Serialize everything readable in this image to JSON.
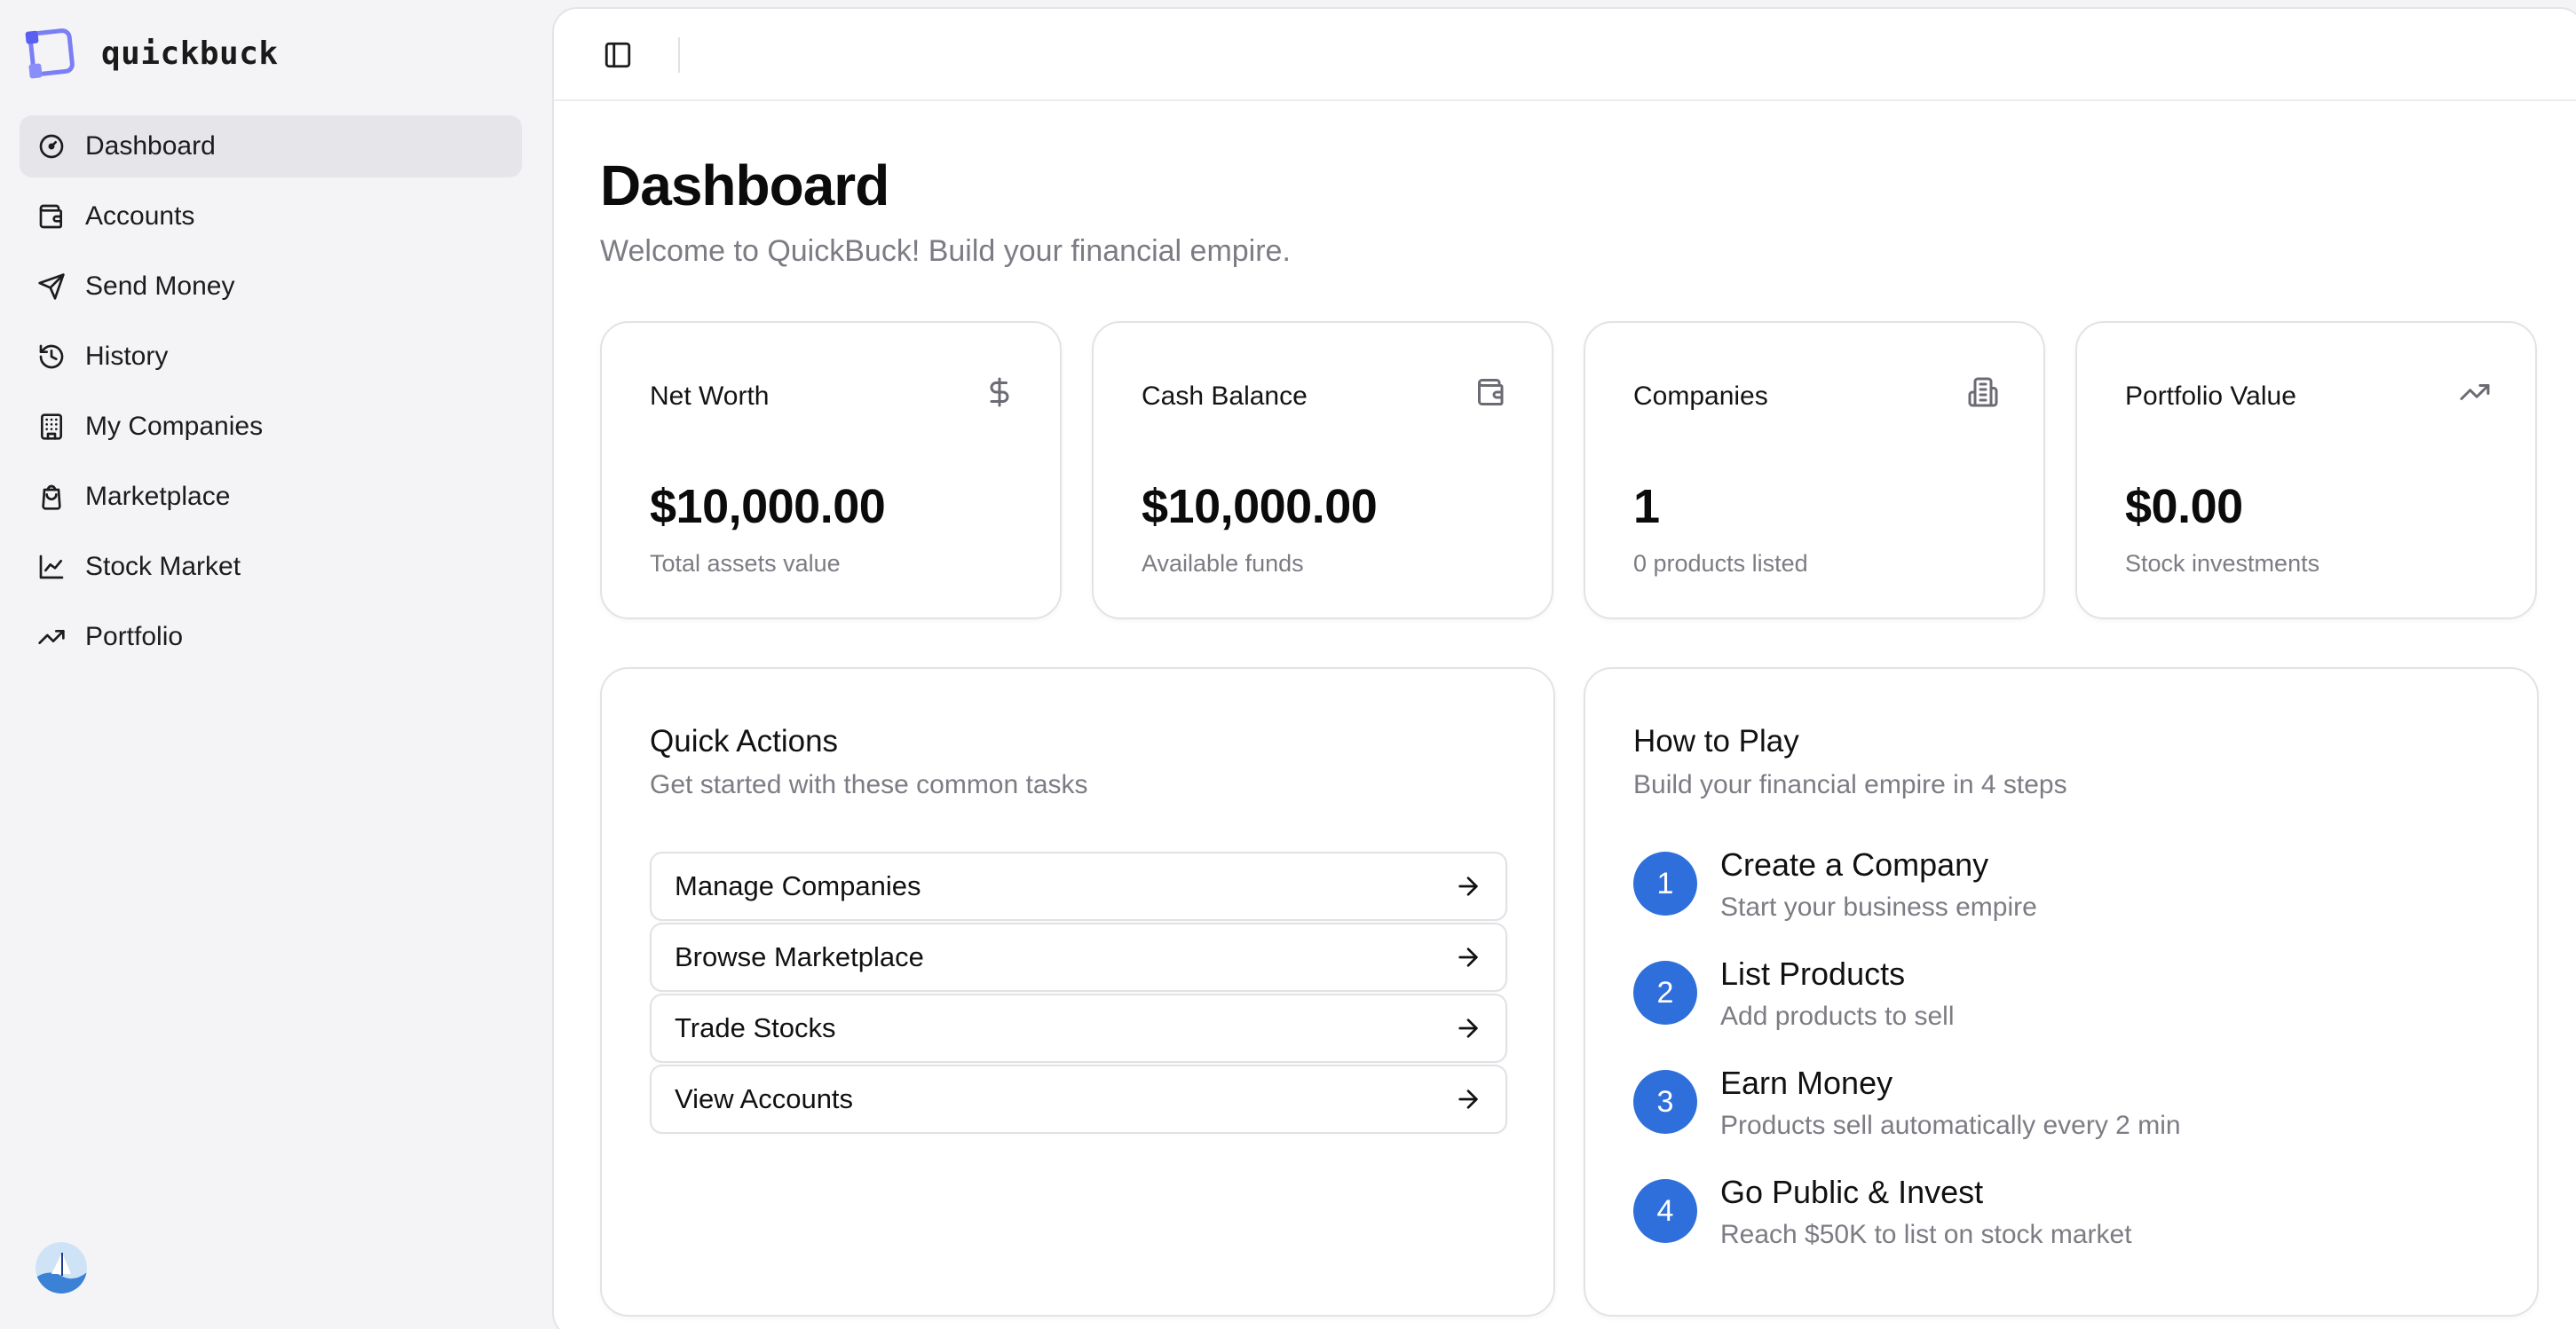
{
  "app": {
    "name": "quickbuck"
  },
  "sidebar": {
    "items": [
      {
        "label": "Dashboard",
        "icon": "gauge-icon",
        "active": true
      },
      {
        "label": "Accounts",
        "icon": "wallet-icon",
        "active": false
      },
      {
        "label": "Send Money",
        "icon": "send-icon",
        "active": false
      },
      {
        "label": "History",
        "icon": "history-icon",
        "active": false
      },
      {
        "label": "My Companies",
        "icon": "building-icon",
        "active": false
      },
      {
        "label": "Marketplace",
        "icon": "shopping-bag-icon",
        "active": false
      },
      {
        "label": "Stock Market",
        "icon": "line-chart-icon",
        "active": false
      },
      {
        "label": "Portfolio",
        "icon": "trending-up-icon",
        "active": false
      }
    ]
  },
  "header": {
    "title": "Dashboard",
    "subtitle": "Welcome to QuickBuck! Build your financial empire."
  },
  "stats": [
    {
      "label": "Net Worth",
      "value": "$10,000.00",
      "caption": "Total assets value",
      "icon": "dollar-icon"
    },
    {
      "label": "Cash Balance",
      "value": "$10,000.00",
      "caption": "Available funds",
      "icon": "wallet-icon"
    },
    {
      "label": "Companies",
      "value": "1",
      "caption": "0 products listed",
      "icon": "building-icon"
    },
    {
      "label": "Portfolio Value",
      "value": "$0.00",
      "caption": "Stock investments",
      "icon": "trending-up-icon"
    }
  ],
  "quick_actions": {
    "title": "Quick Actions",
    "subtitle": "Get started with these common tasks",
    "items": [
      {
        "label": "Manage Companies"
      },
      {
        "label": "Browse Marketplace"
      },
      {
        "label": "Trade Stocks"
      },
      {
        "label": "View Accounts"
      }
    ]
  },
  "how_to_play": {
    "title": "How to Play",
    "subtitle": "Build your financial empire in 4 steps",
    "steps": [
      {
        "number": "1",
        "title": "Create a Company",
        "desc": "Start your business empire"
      },
      {
        "number": "2",
        "title": "List Products",
        "desc": "Add products to sell"
      },
      {
        "number": "3",
        "title": "Earn Money",
        "desc": "Products sell automatically every 2 min"
      },
      {
        "number": "4",
        "title": "Go Public & Invest",
        "desc": "Reach $50K to list on stock market"
      }
    ]
  },
  "colors": {
    "accent": "#2f6fdc",
    "logo": "#6366f1",
    "sidebar_bg": "#f4f4f6",
    "active_item_bg": "#e6e6ea",
    "muted_text": "#7c7c84"
  }
}
